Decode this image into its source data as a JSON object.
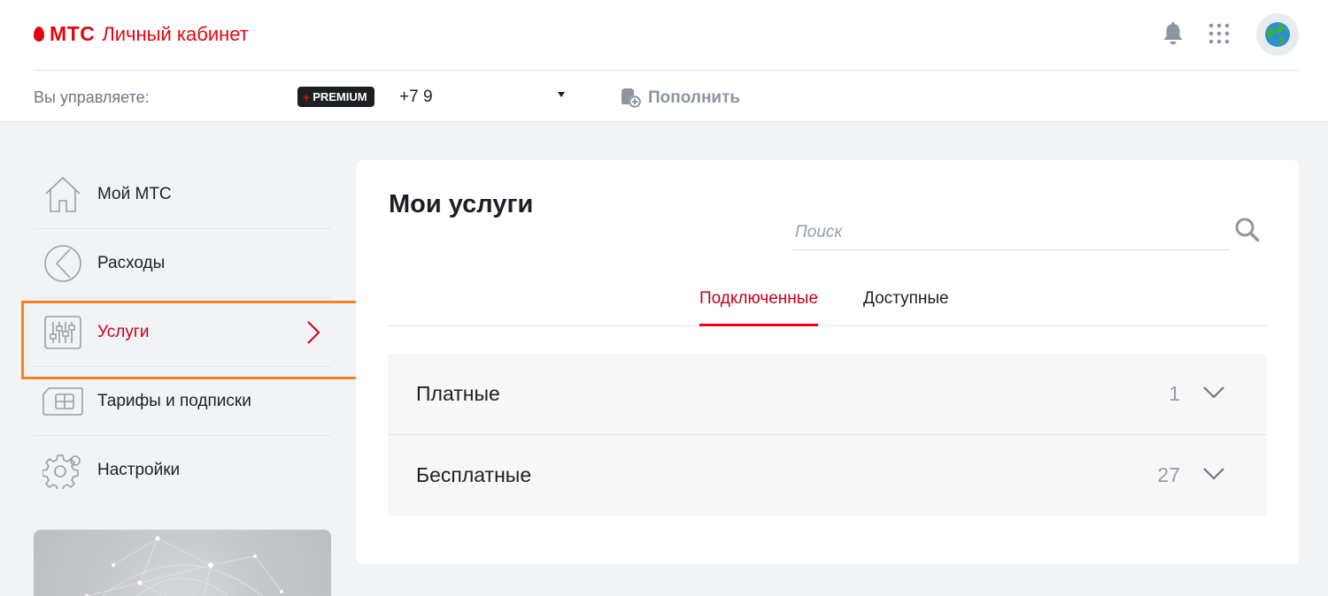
{
  "header": {
    "brand": "МТС",
    "cabinet_title": "Личный кабинет",
    "manage_label": "Вы управляете:",
    "premium_badge": "PREMIUM",
    "premium_plus": "+",
    "phone": "+7 9",
    "topup_label": "Пополнить"
  },
  "sidebar": {
    "items": [
      {
        "label": "Мой МТС",
        "icon": "home-icon"
      },
      {
        "label": "Расходы",
        "icon": "pie-chart-icon"
      },
      {
        "label": "Услуги",
        "icon": "sliders-icon",
        "active": true
      },
      {
        "label": "Тарифы и подписки",
        "icon": "sim-card-icon"
      },
      {
        "label": "Настройки",
        "icon": "gear-icon"
      }
    ]
  },
  "main": {
    "title": "Мои услуги",
    "search_placeholder": "Поиск",
    "tabs": [
      {
        "label": "Подключенные",
        "active": true
      },
      {
        "label": "Доступные",
        "active": false
      }
    ],
    "groups": [
      {
        "label": "Платные",
        "count": "1"
      },
      {
        "label": "Бесплатные",
        "count": "27"
      }
    ]
  },
  "colors": {
    "brand_red": "#e30611",
    "active_red": "#c6001b",
    "highlight_orange": "#f58220"
  }
}
